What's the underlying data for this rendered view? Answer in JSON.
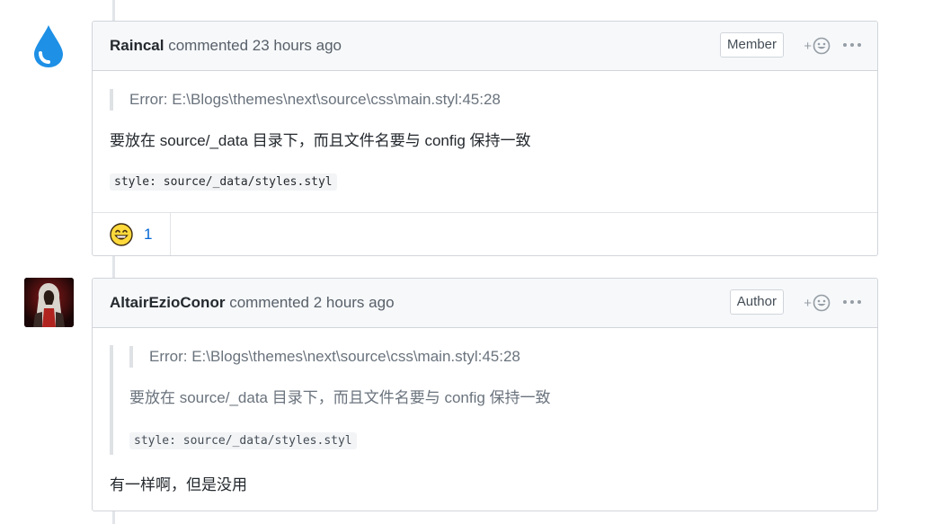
{
  "comments": [
    {
      "author": "Raincal",
      "meta": "commented 23 hours ago",
      "role": "Member",
      "reaction_add_label": "+",
      "quote": "Error: E:\\Blogs\\themes\\next\\source\\css\\main.styl:45:28",
      "body_text": "要放在 source/_data 目录下，而且文件名要与 config 保持一致",
      "code": "style: source/_data/styles.styl",
      "reactions": [
        {
          "icon": "smile-emoji-icon",
          "count": "1"
        }
      ]
    },
    {
      "author": "AltairEzioConor",
      "meta": "commented 2 hours ago",
      "role": "Author",
      "reaction_add_label": "+",
      "quote": {
        "nested_quote": "Error: E:\\Blogs\\themes\\next\\source\\css\\main.styl:45:28",
        "text": "要放在 source/_data 目录下，而且文件名要与 config 保持一致",
        "code": "style: source/_data/styles.styl"
      },
      "body_text": "有一样啊，但是没用"
    }
  ],
  "colors": {
    "link": "#0366d6",
    "header_bg": "#f6f8fa",
    "border": "#d1d5da",
    "avatar_drop": "#1e90e6"
  }
}
